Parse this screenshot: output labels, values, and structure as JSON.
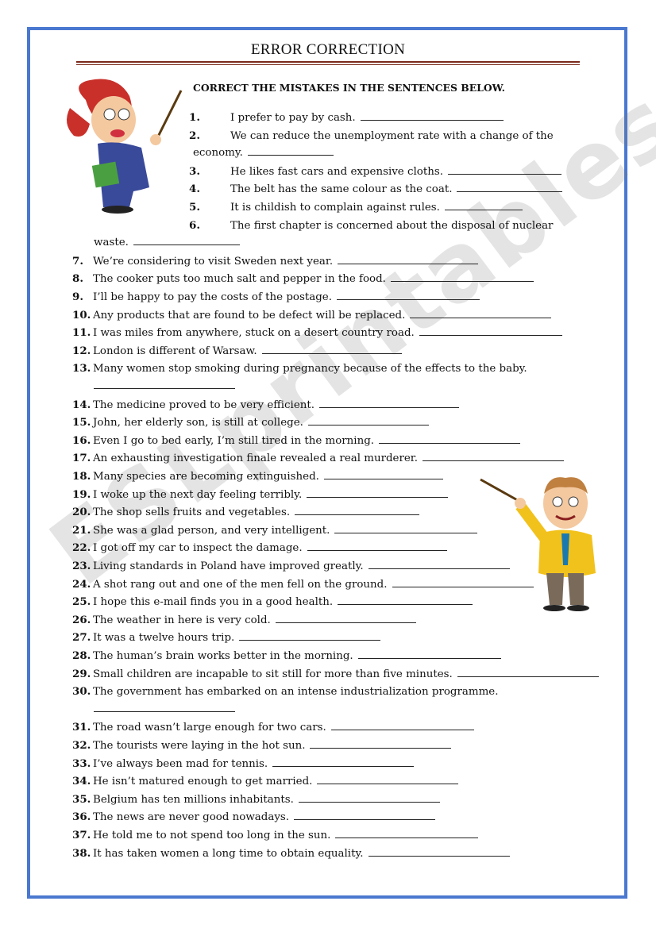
{
  "worksheet": {
    "title": "ERROR CORRECTION",
    "instruction": "CORRECT THE MISTAKES IN THE SENTENCES BELOW.",
    "watermark": "ESLprintables.com",
    "border_color": "#4a78d0",
    "rule_color": "#7a2a1a",
    "items": [
      {
        "n": "1.",
        "text": "I prefer to pay by cash."
      },
      {
        "n": "2.",
        "text": "We can reduce the unemployment rate with a change of the",
        "cont": "economy."
      },
      {
        "n": "3.",
        "text": "He likes fast cars and expensive cloths."
      },
      {
        "n": "4.",
        "text": "The belt  has the same colour as the coat."
      },
      {
        "n": "5.",
        "text": "It is childish to complain against rules."
      },
      {
        "n": "6.",
        "text": "The first chapter is concerned about the disposal of nuclear",
        "cont": "waste."
      },
      {
        "n": "7.",
        "text": "We’re considering to visit Sweden next year."
      },
      {
        "n": "8.",
        "text": "The cooker puts too much salt and pepper in the food."
      },
      {
        "n": "9.",
        "text": "I’ll be happy to pay the costs of the postage."
      },
      {
        "n": "10.",
        "text": "Any products that are found to be defect will be replaced."
      },
      {
        "n": "11.",
        "text": "I was miles from anywhere, stuck on a desert country road."
      },
      {
        "n": "12.",
        "text": "London is different of Warsaw."
      },
      {
        "n": "13.",
        "text": "Many women stop smoking during pregnancy because of the effects to the baby."
      },
      {
        "n": "14.",
        "text": "The medicine proved to be very efficient."
      },
      {
        "n": "15.",
        "text": "John, her elderly son, is still at college."
      },
      {
        "n": "16.",
        "text": "Even I go to bed early, I’m still tired in the morning."
      },
      {
        "n": "17.",
        "text": "An exhausting investigation finale revealed a real murderer."
      },
      {
        "n": "18.",
        "text": "Many species are becoming extinguished."
      },
      {
        "n": "19.",
        "text": "I woke up the next day feeling terribly."
      },
      {
        "n": "20.",
        "text": "The shop sells fruits and vegetables."
      },
      {
        "n": "21.",
        "text": "She was a glad person, and very intelligent."
      },
      {
        "n": "22.",
        "text": "I got off my car to inspect the damage."
      },
      {
        "n": "23.",
        "text": "Living standards in Poland have improved greatly."
      },
      {
        "n": "24.",
        "text": "A shot rang out and one of the men fell on the ground."
      },
      {
        "n": "25.",
        "text": "I hope this e-mail finds you in a good health."
      },
      {
        "n": "26.",
        "text": "The weather in here is very cold."
      },
      {
        "n": "27.",
        "text": "It was a twelve hours trip."
      },
      {
        "n": "28.",
        "text": "The human’s brain works better in the morning."
      },
      {
        "n": "29.",
        "text": "Small children are incapable to sit still for more than five minutes."
      },
      {
        "n": "30.",
        "text": "The government has embarked on an intense industrialization programme."
      },
      {
        "n": "31.",
        "text": "The road wasn’t large enough for two cars."
      },
      {
        "n": "32.",
        "text": "The tourists were laying in the hot sun."
      },
      {
        "n": "33.",
        "text": "I’ve always been mad for tennis."
      },
      {
        "n": "34.",
        "text": "He isn’t matured enough to get married."
      },
      {
        "n": "35.",
        "text": "Belgium has ten millions inhabitants."
      },
      {
        "n": "36.",
        "text": "The news are never good nowadays."
      },
      {
        "n": "37.",
        "text": "He told me to not spend too long in the sun."
      },
      {
        "n": "38.",
        "text": "It has taken women a long time to obtain equality."
      }
    ]
  }
}
